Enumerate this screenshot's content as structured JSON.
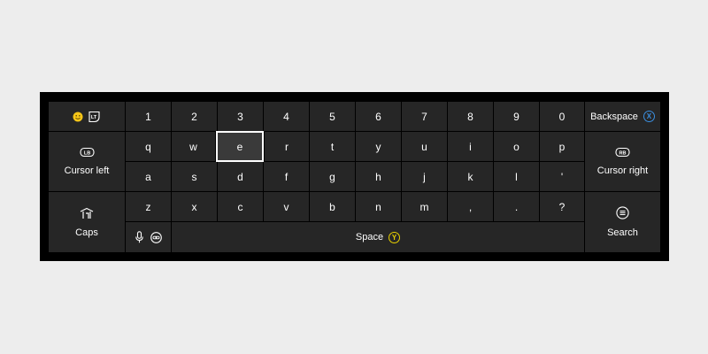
{
  "keyboard": {
    "number_row": [
      "1",
      "2",
      "3",
      "4",
      "5",
      "6",
      "7",
      "8",
      "9",
      "0"
    ],
    "row_q": [
      "q",
      "w",
      "e",
      "r",
      "t",
      "y",
      "u",
      "i",
      "o",
      "p"
    ],
    "row_a": [
      "a",
      "s",
      "d",
      "f",
      "g",
      "h",
      "j",
      "k",
      "l",
      "'"
    ],
    "row_z": [
      "z",
      "x",
      "c",
      "v",
      "b",
      "n",
      "m",
      ",",
      ".",
      "?"
    ],
    "focused_key": "e"
  },
  "left": {
    "cursor_left_label": "Cursor left",
    "cursor_left_badge": "LB",
    "caps_label": "Caps",
    "emoji_trigger_badge": "LT"
  },
  "right": {
    "backspace_label": "Backspace",
    "backspace_badge": "X",
    "cursor_right_label": "Cursor right",
    "cursor_right_badge": "RB",
    "search_label": "Search"
  },
  "bottom": {
    "space_label": "Space",
    "space_badge": "Y"
  },
  "colors": {
    "page_bg": "#ededed",
    "panel_bg": "#000000",
    "key_bg": "#262626",
    "x_badge": "#3b8fe0",
    "y_badge": "#e8d000",
    "emoji_yellow": "#f5c518"
  },
  "icons": [
    "emoji-icon",
    "lt-trigger-icon",
    "lb-bumper-icon",
    "caps-arrow-icon",
    "microphone-icon",
    "link-icon",
    "rb-bumper-icon",
    "menu-icon"
  ]
}
